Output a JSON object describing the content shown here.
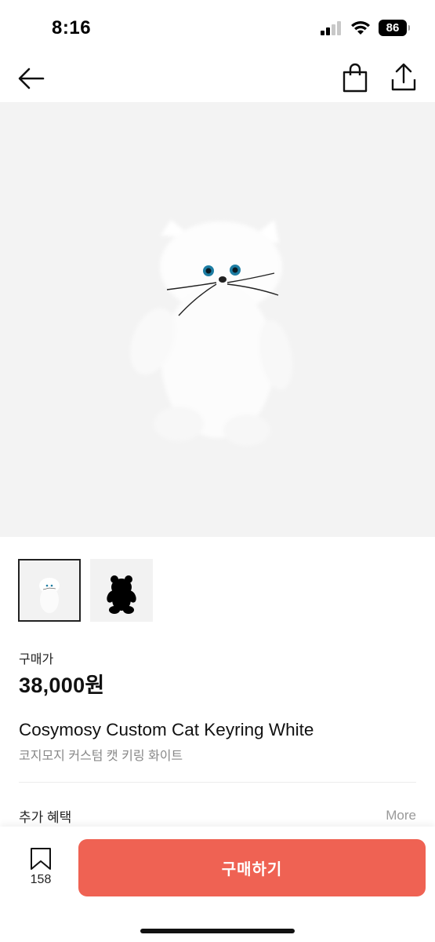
{
  "status_bar": {
    "time": "8:16",
    "battery": "86",
    "icons": [
      "signal-icon",
      "wifi-icon",
      "battery-icon"
    ]
  },
  "nav": {
    "icons": [
      "back-arrow-icon",
      "shopping-bag-icon",
      "share-icon"
    ]
  },
  "product": {
    "thumbnails": [
      {
        "name": "white-cat-keyring",
        "selected": true
      },
      {
        "name": "black-bear-keyring",
        "selected": false
      }
    ],
    "price_label": "구매가",
    "price": "38,000원",
    "title_en": "Cosymosy Custom Cat Keyring White",
    "title_ko": "코지모지 커스텀 캣 키링 화이트"
  },
  "benefits": {
    "label": "추가 혜택",
    "more": "More"
  },
  "bottom_bar": {
    "bookmark_count": "158",
    "buy_label": "구매하기",
    "buy_color": "#ef6253"
  }
}
